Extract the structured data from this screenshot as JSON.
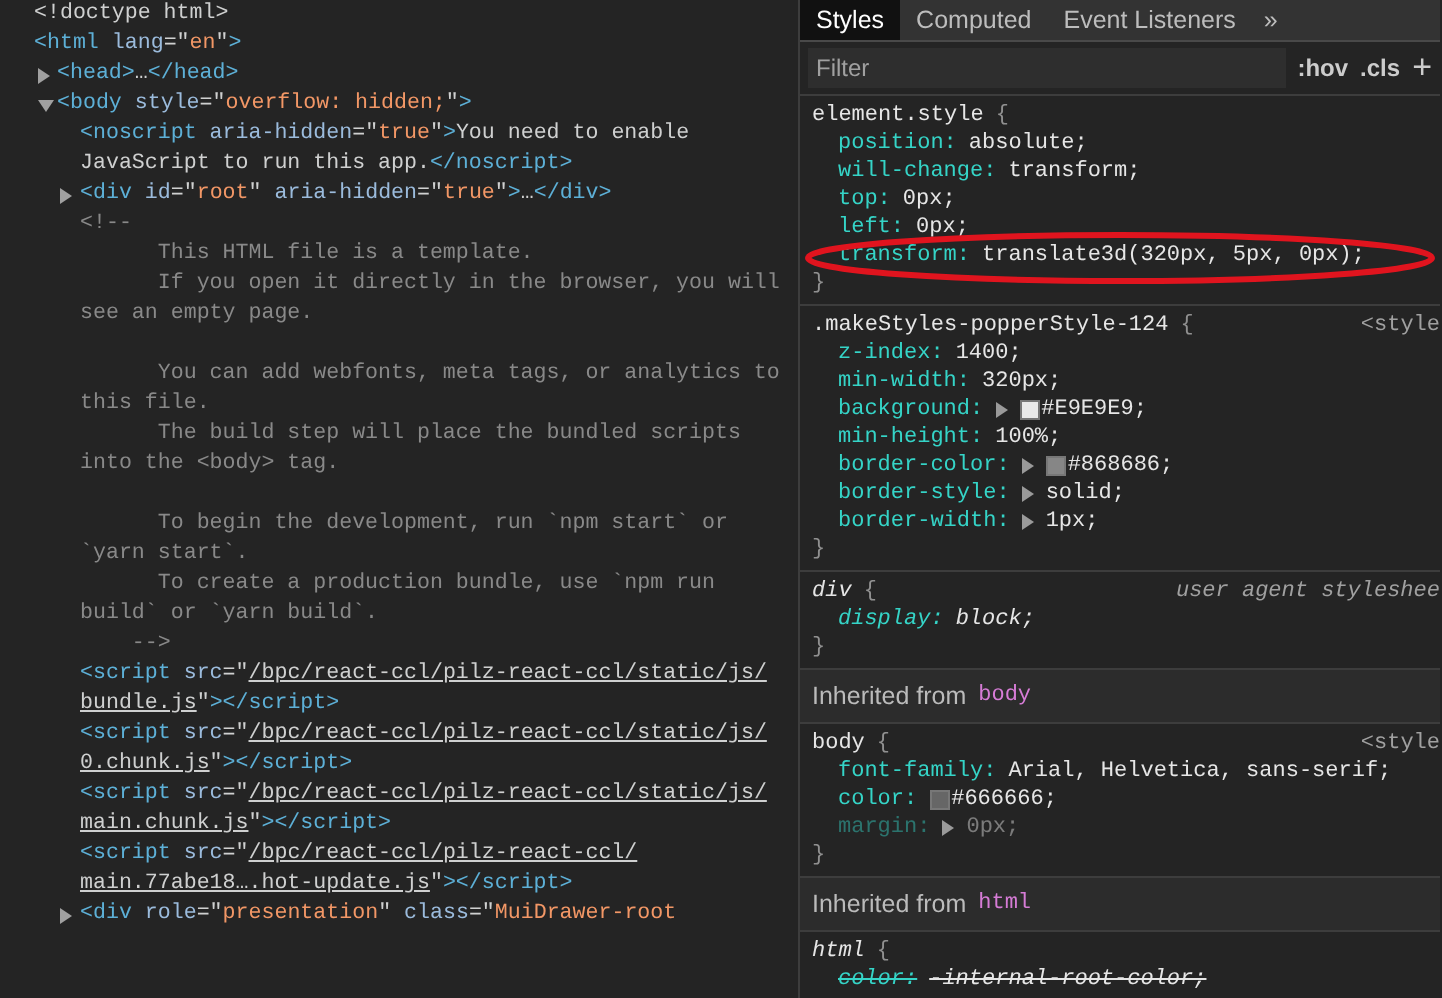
{
  "elements_panel": {
    "nodes": [
      {
        "kind": "element",
        "lines": [
          [
            {
              "kind": "text",
              "text": "<!doctype html>"
            }
          ]
        ]
      },
      {
        "kind": "element",
        "lines": [
          [
            {
              "kind": "tag",
              "text": "<html"
            },
            {
              "kind": "attr",
              "text": " lang"
            },
            {
              "kind": "punct",
              "text": "=\""
            },
            {
              "kind": "value",
              "text": "en"
            },
            {
              "kind": "punct",
              "text": "\""
            },
            {
              "kind": "tag",
              "text": ">"
            }
          ]
        ],
        "children": [
          {
            "kind": "element",
            "expanded": false,
            "lines": [
              [
                {
                  "kind": "tag",
                  "text": "<head>"
                },
                {
                  "kind": "text",
                  "text": "…"
                },
                {
                  "kind": "tag",
                  "text": "</head>"
                }
              ]
            ]
          },
          {
            "kind": "element",
            "expanded": true,
            "lines": [
              [
                {
                  "kind": "tag",
                  "text": "<body"
                },
                {
                  "kind": "attr",
                  "text": " style"
                },
                {
                  "kind": "punct",
                  "text": "=\""
                },
                {
                  "kind": "value",
                  "text": "overflow: hidden;"
                },
                {
                  "kind": "punct",
                  "text": "\""
                },
                {
                  "kind": "tag",
                  "text": ">"
                }
              ]
            ],
            "children": [
              {
                "kind": "element",
                "lines": [
                  [
                    {
                      "kind": "tag",
                      "text": "<noscript"
                    },
                    {
                      "kind": "attr",
                      "text": " aria-hidden"
                    },
                    {
                      "kind": "punct",
                      "text": "=\""
                    },
                    {
                      "kind": "value",
                      "text": "true"
                    },
                    {
                      "kind": "punct",
                      "text": "\""
                    },
                    {
                      "kind": "tag",
                      "text": ">"
                    },
                    {
                      "kind": "text",
                      "text": "You need to enable"
                    }
                  ],
                  [
                    {
                      "kind": "text",
                      "text": "JavaScript to run this app."
                    },
                    {
                      "kind": "tag",
                      "text": "</noscript>"
                    }
                  ]
                ]
              },
              {
                "kind": "element",
                "expanded": false,
                "lines": [
                  [
                    {
                      "kind": "tag",
                      "text": "<div"
                    },
                    {
                      "kind": "attr",
                      "text": " id"
                    },
                    {
                      "kind": "punct",
                      "text": "=\""
                    },
                    {
                      "kind": "value",
                      "text": "root"
                    },
                    {
                      "kind": "punct",
                      "text": "\""
                    },
                    {
                      "kind": "attr",
                      "text": " aria-hidden"
                    },
                    {
                      "kind": "punct",
                      "text": "=\""
                    },
                    {
                      "kind": "value",
                      "text": "true"
                    },
                    {
                      "kind": "punct",
                      "text": "\""
                    },
                    {
                      "kind": "tag",
                      "text": ">"
                    },
                    {
                      "kind": "text",
                      "text": "…"
                    },
                    {
                      "kind": "tag",
                      "text": "</div>"
                    }
                  ]
                ]
              },
              {
                "kind": "comment",
                "text": "<!--\n      This HTML file is a template.\n      If you open it directly in the browser, you will\nsee an empty page.\n\n      You can add webfonts, meta tags, or analytics to\nthis file.\n      The build step will place the bundled scripts\ninto the <body> tag.\n\n      To begin the development, run `npm start` or\n`yarn start`.\n      To create a production bundle, use `npm run\nbuild` or `yarn build`.\n    -->"
              },
              {
                "kind": "element",
                "lines": [
                  [
                    {
                      "kind": "tag",
                      "text": "<script"
                    },
                    {
                      "kind": "attr",
                      "text": " src"
                    },
                    {
                      "kind": "punct",
                      "text": "=\""
                    },
                    {
                      "kind": "link",
                      "text": "/bpc/react-ccl/pilz-react-ccl/static/js/"
                    }
                  ],
                  [
                    {
                      "kind": "link",
                      "text": "bundle.js"
                    },
                    {
                      "kind": "punct",
                      "text": "\""
                    },
                    {
                      "kind": "tag",
                      "text": "></script>"
                    }
                  ]
                ]
              },
              {
                "kind": "element",
                "lines": [
                  [
                    {
                      "kind": "tag",
                      "text": "<script"
                    },
                    {
                      "kind": "attr",
                      "text": " src"
                    },
                    {
                      "kind": "punct",
                      "text": "=\""
                    },
                    {
                      "kind": "link",
                      "text": "/bpc/react-ccl/pilz-react-ccl/static/js/"
                    }
                  ],
                  [
                    {
                      "kind": "link",
                      "text": "0.chunk.js"
                    },
                    {
                      "kind": "punct",
                      "text": "\""
                    },
                    {
                      "kind": "tag",
                      "text": "></script>"
                    }
                  ]
                ]
              },
              {
                "kind": "element",
                "lines": [
                  [
                    {
                      "kind": "tag",
                      "text": "<script"
                    },
                    {
                      "kind": "attr",
                      "text": " src"
                    },
                    {
                      "kind": "punct",
                      "text": "=\""
                    },
                    {
                      "kind": "link",
                      "text": "/bpc/react-ccl/pilz-react-ccl/static/js/"
                    }
                  ],
                  [
                    {
                      "kind": "link",
                      "text": "main.chunk.js"
                    },
                    {
                      "kind": "punct",
                      "text": "\""
                    },
                    {
                      "kind": "tag",
                      "text": "></script>"
                    }
                  ]
                ]
              },
              {
                "kind": "element",
                "lines": [
                  [
                    {
                      "kind": "tag",
                      "text": "<script"
                    },
                    {
                      "kind": "attr",
                      "text": " src"
                    },
                    {
                      "kind": "punct",
                      "text": "=\""
                    },
                    {
                      "kind": "link",
                      "text": "/bpc/react-ccl/pilz-react-ccl/"
                    }
                  ],
                  [
                    {
                      "kind": "link",
                      "text": "main.77abe18….hot-update.js"
                    },
                    {
                      "kind": "punct",
                      "text": "\""
                    },
                    {
                      "kind": "tag",
                      "text": "></script>"
                    }
                  ]
                ]
              },
              {
                "kind": "element",
                "expanded": false,
                "lines": [
                  [
                    {
                      "kind": "tag",
                      "text": "<div"
                    },
                    {
                      "kind": "attr",
                      "text": " role"
                    },
                    {
                      "kind": "punct",
                      "text": "=\""
                    },
                    {
                      "kind": "value",
                      "text": "presentation"
                    },
                    {
                      "kind": "punct",
                      "text": "\""
                    },
                    {
                      "kind": "attr",
                      "text": " class"
                    },
                    {
                      "kind": "punct",
                      "text": "=\""
                    },
                    {
                      "kind": "value",
                      "text": "MuiDrawer-root"
                    }
                  ]
                ]
              }
            ]
          }
        ]
      }
    ]
  },
  "styles_pane": {
    "tabs": [
      {
        "label": "Styles",
        "selected": true
      },
      {
        "label": "Computed",
        "selected": false
      },
      {
        "label": "Event Listeners",
        "selected": false
      }
    ],
    "more": "»",
    "filter": {
      "placeholder": "Filter"
    },
    "toggles": [
      ":hov",
      ".cls",
      "+"
    ],
    "sections": [
      {
        "kind": "author-rule",
        "selector": "element.style",
        "open_brace": "{",
        "close_brace": "}",
        "properties": [
          {
            "name": "position:",
            "value": "absolute;",
            "inactive": false,
            "struck": false
          },
          {
            "name": "will-change:",
            "value": "transform;",
            "inactive": false,
            "struck": false
          },
          {
            "name": "top:",
            "value": "0px;",
            "inactive": false,
            "struck": false
          },
          {
            "name": "left:",
            "value": "0px;",
            "inactive": false,
            "struck": false
          },
          {
            "name": "transform:",
            "value": "translate3d(320px, 5px, 0px);",
            "inactive": false,
            "struck": false,
            "highlighted": true
          }
        ]
      },
      {
        "kind": "author-rule",
        "selector": ".makeStyles-popperStyle-124",
        "open_brace": "{",
        "close_brace": "}",
        "source": "<style",
        "properties": [
          {
            "name": "z-index:",
            "value": "1400;",
            "inactive": false,
            "struck": false
          },
          {
            "name": "min-width:",
            "value": "320px;",
            "inactive": false,
            "struck": false
          },
          {
            "name": "background:",
            "value": "#E9E9E9;",
            "color": "#e9e9e9",
            "expandable": true,
            "inactive": false,
            "struck": false
          },
          {
            "name": "min-height:",
            "value": "100%;",
            "inactive": false,
            "struck": false
          },
          {
            "name": "border-color:",
            "value": "#868686;",
            "color": "#868686",
            "expandable": true,
            "inactive": false,
            "struck": false
          },
          {
            "name": "border-style:",
            "value": "solid;",
            "expandable": true,
            "inactive": false,
            "struck": false
          },
          {
            "name": "border-width:",
            "value": "1px;",
            "expandable": true,
            "inactive": false,
            "struck": false
          }
        ]
      },
      {
        "kind": "user-agent-rule",
        "selector": "div",
        "open_brace": "{",
        "close_brace": "}",
        "source": "user agent styleshee",
        "properties": [
          {
            "name": "display:",
            "value": "block;",
            "inactive": false,
            "struck": false
          }
        ]
      },
      {
        "kind": "inherited",
        "label": "Inherited from",
        "element": "body"
      },
      {
        "kind": "author-rule",
        "selector": "body",
        "open_brace": "{",
        "close_brace": "}",
        "source": "<style",
        "properties": [
          {
            "name": "font-family:",
            "value": "Arial, Helvetica, sans-serif;",
            "inactive": false,
            "struck": false
          },
          {
            "name": "color:",
            "value": "#666666;",
            "color": "#666666",
            "inactive": false,
            "struck": false
          },
          {
            "name": "margin:",
            "value": "0px;",
            "expandable": true,
            "inactive": true,
            "struck": false
          }
        ]
      },
      {
        "kind": "inherited",
        "label": "Inherited from",
        "element": "html"
      },
      {
        "kind": "user-agent-rule",
        "selector": "html",
        "open_brace": "{",
        "properties": [
          {
            "name": "color:",
            "value": "-internal-root-color;",
            "inactive": false,
            "struck": true
          }
        ]
      }
    ]
  }
}
